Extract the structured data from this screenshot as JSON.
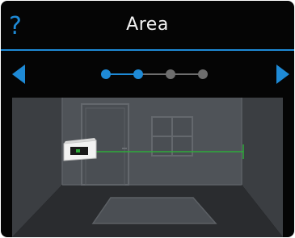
{
  "header": {
    "help_label": "?",
    "title": "Area"
  },
  "pager": {
    "total_steps": 4,
    "current_step": 2,
    "active_color": "#1e8ad6",
    "inactive_color": "#6e6e6e"
  },
  "icons": {
    "help": "question-mark-icon",
    "prev": "triangle-left-icon",
    "next": "triangle-right-icon",
    "device": "laser-distance-meter-icon"
  },
  "colors": {
    "background": "#050505",
    "accent": "#1e8ad6",
    "title_text": "#f2f2f2",
    "measure_line": "#2eaa3a"
  }
}
